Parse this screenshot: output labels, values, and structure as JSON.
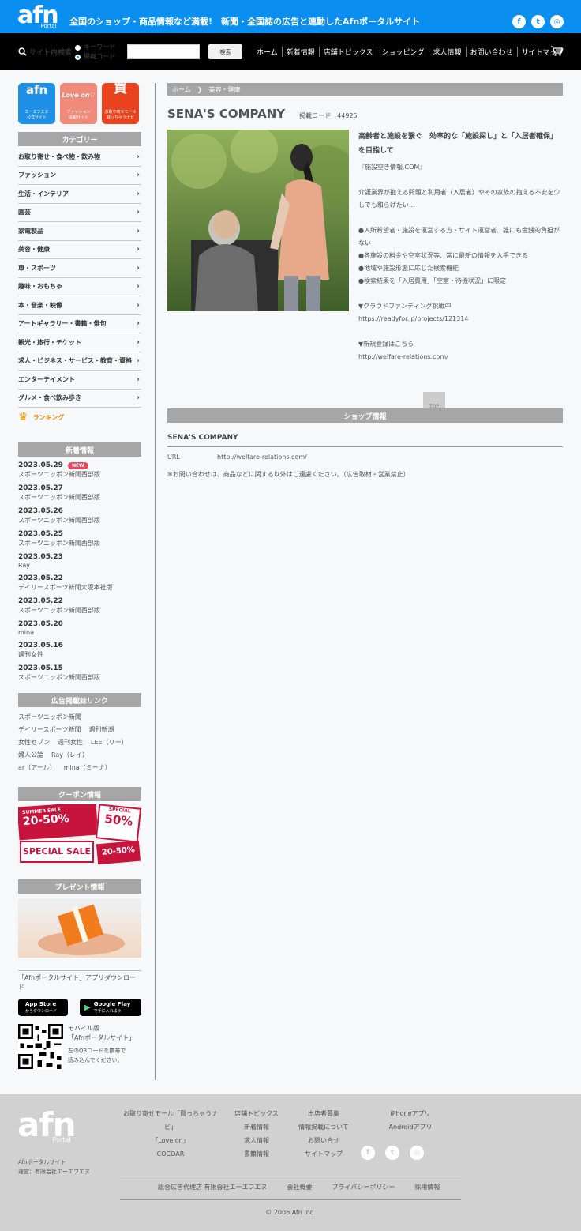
{
  "header": {
    "logo": "afn",
    "logo_sub": "Portal",
    "tagline": "全国のショップ・商品情報など満載!　新聞・全国誌の広告と連動したAfnポータルサイト",
    "social": [
      "f",
      "t",
      "◎"
    ]
  },
  "searchbar": {
    "label": "サイト内検索",
    "radio1": "キーワード",
    "radio2": "掲載コード",
    "button": "検索",
    "nav": [
      "ホーム",
      "新着情報",
      "店舗トピックス",
      "ショッピング",
      "求人情報",
      "お問い合わせ",
      "サイトマップ"
    ]
  },
  "sidebar": {
    "banners": [
      {
        "title": "afn",
        "sub": "エーエフエヌ\n公式サイト",
        "color": "#1e90e8"
      },
      {
        "title": "Love on♡",
        "sub": "ファッション\n情報サイト",
        "color": "#f08a7a"
      },
      {
        "title": "買",
        "sub": "お取り寄せモール\n買っちゃうナビ",
        "color": "#e8431e"
      }
    ],
    "category_title": "カテゴリー",
    "categories": [
      "お取り寄せ・食べ物・飲み物",
      "ファッション",
      "生活・インテリア",
      "園芸",
      "家電製品",
      "美容・健康",
      "車・スポーツ",
      "趣味・おもちゃ",
      "本・音楽・映像",
      "アートギャラリー・書籍・俳句",
      "観光・旅行・チケット",
      "求人・ビジネス・サービス・教育・資格",
      "エンターテイメント",
      "グルメ・食べ飲み歩き"
    ],
    "ranking": "ランキング",
    "news_title": "新着情報",
    "new_badge": "NEW",
    "news": [
      {
        "date": "2023.05.29",
        "src": "スポーツニッポン新聞西部版"
      },
      {
        "date": "2023.05.27",
        "src": "スポーツニッポン新聞西部版"
      },
      {
        "date": "2023.05.26",
        "src": "スポーツニッポン新聞西部版"
      },
      {
        "date": "2023.05.25",
        "src": "スポーツニッポン新聞西部版"
      },
      {
        "date": "2023.05.23",
        "src": "Ray"
      },
      {
        "date": "2023.05.22",
        "src": "デイリースポーツ新聞大阪本社版"
      },
      {
        "date": "2023.05.22",
        "src": "スポーツニッポン新聞西部版"
      },
      {
        "date": "2023.05.20",
        "src": "mina"
      },
      {
        "date": "2023.05.16",
        "src": "週刊女性"
      },
      {
        "date": "2023.05.15",
        "src": "スポーツニッポン新聞西部版"
      }
    ],
    "media_title": "広告掲載誌リンク",
    "media_links": [
      [
        "スポーツニッポン新聞"
      ],
      [
        "デイリースポーツ新聞",
        "週刊新潮"
      ],
      [
        "女性セブン",
        "週刊女性",
        "LEE（リー）"
      ],
      [
        "婦人公論",
        "Ray（レイ）"
      ],
      [
        "ar（アール）",
        "mina（ミーナ）"
      ]
    ],
    "coupon_title": "クーポン情報",
    "coupon_texts": [
      "SUMMER SALE",
      "20-50%",
      "SPECIAL",
      "50%",
      "SPECIAL SALE",
      "20-50%"
    ],
    "present_title": "プレゼント情報",
    "app_text": "「Afnポータルサイト」アプリダウンロード",
    "appstore_small": "App Store",
    "appstore_sub": "からダウンロード",
    "googleplay": "Google Play",
    "googleplay_sub": "で手に入れよう",
    "mobile_title": "モバイル版\n「Afnポータルサイト」",
    "mobile_desc": "左のQRコードを携帯で\n読み込んでください。"
  },
  "main": {
    "breadcrumb": [
      "ホーム",
      "美容・健康"
    ],
    "breadcrumb_sep": "❯",
    "shop_title": "SENA'S COMPANY",
    "code_label": "掲載コード　44925",
    "desc_heading": "高齢者と施設を繋ぐ　効率的な「施設探し」と「入居者確保」を目指して",
    "desc_lines": [
      "『施設空き情報.COM』",
      "",
      "介護業界が抱える問題と利用者（入居者）やその家族の抱える不安を少しでも和らげたい…",
      "",
      "●入所希望者・施設を運営する方・サイト運営者、誰にも金銭的負担がない",
      "●各施設の料金や空室状況等、常に最新の情報を入手できる",
      "●地域や施設形態に応じた検索機能",
      "●検索結果を「入居費用」「空室・待機状況」に限定",
      "",
      "▼クラウドファンディング挑戦中",
      "https://readyfor.jp/projects/121314",
      "",
      "▼新規登録はこちら",
      "http://welfare-relations.com/"
    ],
    "top_label": "TOP",
    "shopinfo_title": "ショップ情報",
    "shopinfo_name": "SENA'S COMPANY",
    "url_label": "URL",
    "url_value": "http://welfare-relations.com/",
    "note": "※お問い合わせは、商品などに関する以外はご遠慮ください。（広告取材・営業禁止）"
  },
  "footer": {
    "logo": "afn",
    "logo_sub": "Portal",
    "site_name": "Afnポータルサイト",
    "operator": "運営：有限会社エーエフエヌ",
    "col1": [
      "お取り寄せモール「買っちゃうナ",
      "ビ」",
      "「Love on」",
      "COCOAR"
    ],
    "col2": [
      "店舗トピックス",
      "新着情報",
      "求人情報",
      "書籍情報"
    ],
    "col3": [
      "出店者募集",
      "情報掲載について",
      "お問い合せ",
      "サイトマップ"
    ],
    "col4": [
      "iPhoneアプリ",
      "Androidアプリ"
    ],
    "bottom_links": [
      "総合広告代理店 有限会社エーエフエヌ",
      "会社概要",
      "プライバシーポリシー",
      "採用情報"
    ],
    "copyright": "© 2006 Afn Inc."
  }
}
